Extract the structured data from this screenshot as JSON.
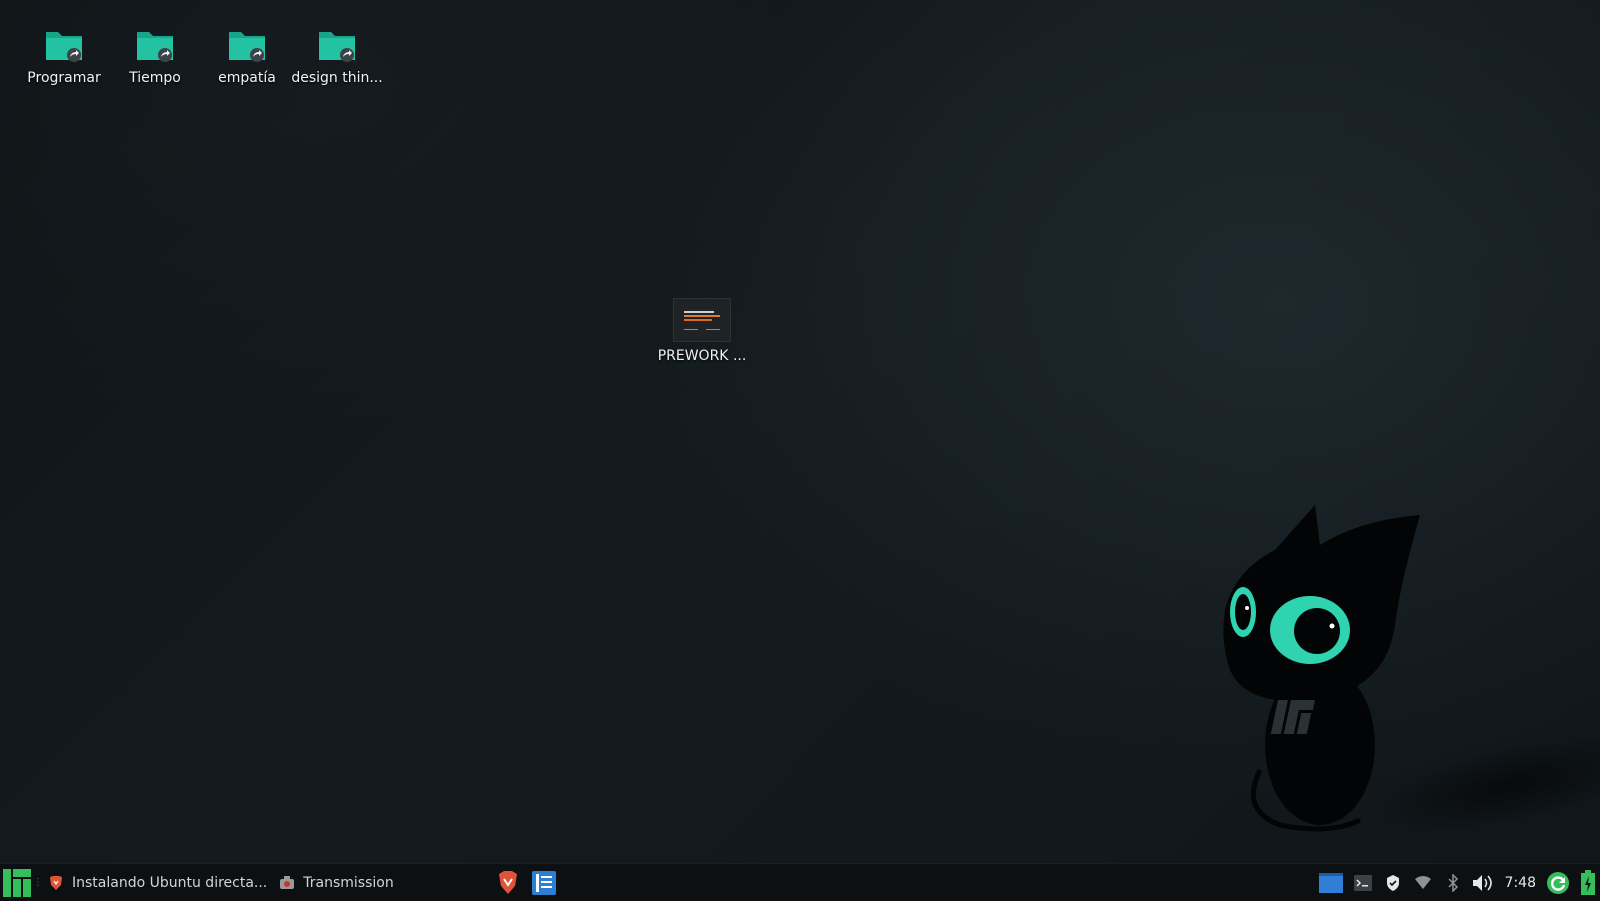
{
  "desktop": {
    "icons": [
      {
        "label": "Programar",
        "icon": "folder-shared-icon"
      },
      {
        "label": "Tiempo",
        "icon": "folder-shared-icon"
      },
      {
        "label": "empatía",
        "icon": "folder-shared-icon"
      },
      {
        "label": "design thin...",
        "icon": "folder-shared-icon"
      }
    ],
    "file": {
      "label": "PREWORK ...",
      "icon": "presentation-thumbnail-icon"
    },
    "wallpaper": {
      "accent": "#3dd1b0",
      "background": "#121a1e"
    }
  },
  "taskbar": {
    "tasks": [
      {
        "label": "Instalando Ubuntu directa...",
        "icon": "brave-icon"
      },
      {
        "label": "Transmission",
        "icon": "transmission-icon"
      }
    ],
    "launchers": [
      {
        "icon": "brave-launcher-icon"
      },
      {
        "icon": "text-editor-launcher-icon"
      }
    ],
    "tray": {
      "clock": "7:48",
      "items": [
        "window-icon",
        "terminal-icon",
        "shield-icon",
        "wifi-icon",
        "bluetooth-icon",
        "volume-icon",
        "update-icon",
        "battery-icon"
      ]
    },
    "colors": {
      "menu": "#35bf5c",
      "accent": "#3dd1b0"
    }
  }
}
